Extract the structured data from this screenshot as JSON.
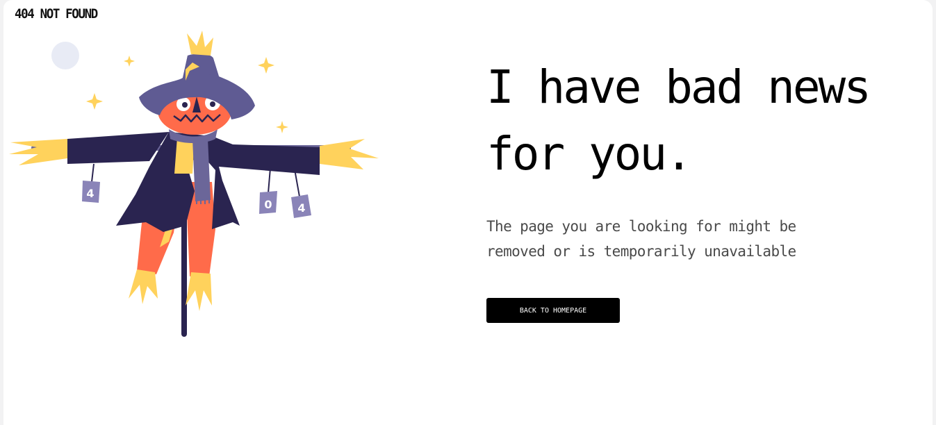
{
  "header": {
    "logo_text": "404 NOT FOUND"
  },
  "illustration": {
    "name": "scarecrow",
    "can_labels": [
      "4",
      "0",
      "4"
    ]
  },
  "main": {
    "headline_line1": "I have bad news",
    "headline_line2": "for you.",
    "subtext_line1": "The page you are looking for might be",
    "subtext_line2": "removed or is temporarily unavailable",
    "button_label": "BACK TO HOMEPAGE"
  },
  "colors": {
    "background": "#ffffff",
    "text": "#000000",
    "button_bg": "#000000",
    "button_text": "#ffffff",
    "hat": "#5f5b93",
    "coat": "#2a2450",
    "face": "#ff6b4a",
    "straw": "#ffd25c",
    "moon": "#e8ebf5"
  }
}
